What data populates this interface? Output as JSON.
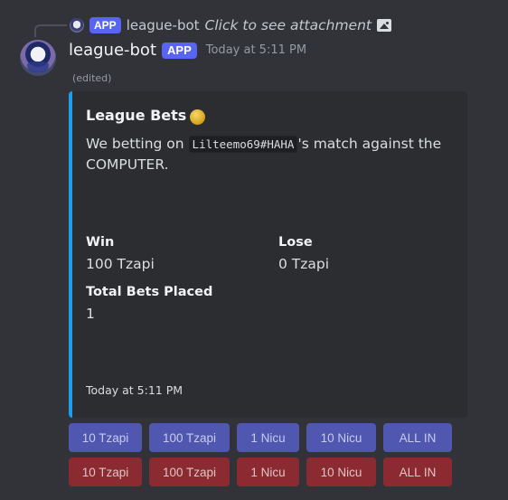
{
  "reply": {
    "badge": "APP",
    "author": "league-bot",
    "text": "Click to see attachment"
  },
  "message": {
    "author": "league-bot",
    "badge": "APP",
    "timestamp": "Today at 5:11 PM",
    "edited": "(edited)"
  },
  "embed": {
    "accent_color": "#1e9cf0",
    "title": "League Bets",
    "desc_before": "We betting on ",
    "desc_code": "Lilteemo69#HAHA",
    "desc_after": "'s match against the COMPUTER.",
    "fields": {
      "win": {
        "name": "Win",
        "value": "100 Tzapi"
      },
      "lose": {
        "name": "Lose",
        "value": "0 Tzapi"
      },
      "total": {
        "name": "Total Bets Placed",
        "value": "1"
      }
    },
    "footer": "Today at 5:11 PM"
  },
  "buttons": {
    "win_row": [
      "10 Tzapi",
      "100 Tzapi",
      "1 Nicu",
      "10 Nicu",
      "ALL IN"
    ],
    "lose_row": [
      "10 Tzapi",
      "100 Tzapi",
      "1 Nicu",
      "10 Nicu",
      "ALL IN"
    ],
    "colors": {
      "win": "#5057b0",
      "lose": "#8b2a31"
    }
  },
  "icons": [
    "mini-avatar-icon",
    "image-icon",
    "coin-icon",
    "avatar"
  ]
}
